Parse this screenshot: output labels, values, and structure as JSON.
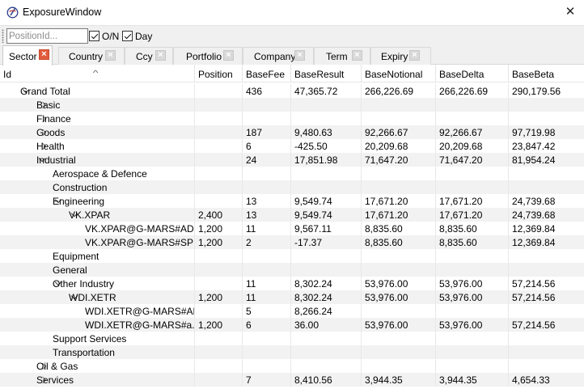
{
  "window": {
    "title": "ExposureWindow",
    "app_icon": "app-logo-icon",
    "close_label": "✕"
  },
  "toolbar": {
    "position_input": {
      "placeholder": "PositionId...",
      "value": ""
    },
    "on_checkbox": {
      "label": "O/N",
      "checked": true
    },
    "day_checkbox": {
      "label": "Day",
      "checked": true
    }
  },
  "tabs": [
    {
      "label": "Sector",
      "active": true
    },
    {
      "label": "Country",
      "active": false
    },
    {
      "label": "Ccy",
      "active": false
    },
    {
      "label": "Portfolio",
      "active": false
    },
    {
      "label": "Company",
      "active": false
    },
    {
      "label": "Term",
      "active": false
    },
    {
      "label": "Expiry",
      "active": false
    }
  ],
  "table": {
    "columns": [
      "Id",
      "Position",
      "BaseFee",
      "BaseResult",
      "BaseNotional",
      "BaseDelta",
      "BaseBeta"
    ],
    "sorted_column": "Id",
    "rows": [
      {
        "id": "Grand Total",
        "level": 0,
        "expander": "expanded",
        "position": "",
        "basefee": "436",
        "baseresult": "47,365.72",
        "basenotional": "266,226.69",
        "basedelta": "266,226.69",
        "basebeta": "290,179.56"
      },
      {
        "id": "Basic",
        "level": 1,
        "expander": "collapsed",
        "position": "",
        "basefee": "",
        "baseresult": "",
        "basenotional": "",
        "basedelta": "",
        "basebeta": ""
      },
      {
        "id": "Finance",
        "level": 1,
        "expander": "collapsed",
        "position": "",
        "basefee": "",
        "baseresult": "",
        "basenotional": "",
        "basedelta": "",
        "basebeta": ""
      },
      {
        "id": "Goods",
        "level": 1,
        "expander": "collapsed",
        "position": "",
        "basefee": "187",
        "baseresult": "9,480.63",
        "basenotional": "92,266.67",
        "basedelta": "92,266.67",
        "basebeta": "97,719.98"
      },
      {
        "id": "Health",
        "level": 1,
        "expander": "collapsed",
        "position": "",
        "basefee": "6",
        "baseresult": "-425.50",
        "basenotional": "20,209.68",
        "basedelta": "20,209.68",
        "basebeta": "23,847.42"
      },
      {
        "id": "Industrial",
        "level": 1,
        "expander": "expanded",
        "position": "",
        "basefee": "24",
        "baseresult": "17,851.98",
        "basenotional": "71,647.20",
        "basedelta": "71,647.20",
        "basebeta": "81,954.24"
      },
      {
        "id": "Aerospace & Defence",
        "level": 2,
        "expander": "none",
        "position": "",
        "basefee": "",
        "baseresult": "",
        "basenotional": "",
        "basedelta": "",
        "basebeta": ""
      },
      {
        "id": "Construction",
        "level": 2,
        "expander": "none",
        "position": "",
        "basefee": "",
        "baseresult": "",
        "basenotional": "",
        "basedelta": "",
        "basebeta": ""
      },
      {
        "id": "Engineering",
        "level": 2,
        "expander": "expanded",
        "position": "",
        "basefee": "13",
        "baseresult": "9,549.74",
        "basenotional": "17,671.20",
        "basedelta": "17,671.20",
        "basebeta": "24,739.68"
      },
      {
        "id": "VK.XPAR",
        "level": 3,
        "expander": "expanded",
        "position": "2,400",
        "basefee": "13",
        "baseresult": "9,549.74",
        "basenotional": "17,671.20",
        "basedelta": "17,671.20",
        "basebeta": "24,739.68"
      },
      {
        "id": "VK.XPAR@G-MARS#AD",
        "level": 4,
        "expander": "none",
        "position": "1,200",
        "basefee": "11",
        "baseresult": "9,567.11",
        "basenotional": "8,835.60",
        "basedelta": "8,835.60",
        "basebeta": "12,369.84"
      },
      {
        "id": "VK.XPAR@G-MARS#SP",
        "level": 4,
        "expander": "none",
        "position": "1,200",
        "basefee": "2",
        "baseresult": "-17.37",
        "basenotional": "8,835.60",
        "basedelta": "8,835.60",
        "basebeta": "12,369.84"
      },
      {
        "id": "Equipment",
        "level": 2,
        "expander": "none",
        "position": "",
        "basefee": "",
        "baseresult": "",
        "basenotional": "",
        "basedelta": "",
        "basebeta": ""
      },
      {
        "id": "General",
        "level": 2,
        "expander": "none",
        "position": "",
        "basefee": "",
        "baseresult": "",
        "basenotional": "",
        "basedelta": "",
        "basebeta": ""
      },
      {
        "id": "Other Industry",
        "level": 2,
        "expander": "expanded",
        "position": "",
        "basefee": "11",
        "baseresult": "8,302.24",
        "basenotional": "53,976.00",
        "basedelta": "53,976.00",
        "basebeta": "57,214.56"
      },
      {
        "id": "WDI.XETR",
        "level": 3,
        "expander": "expanded",
        "position": "1,200",
        "basefee": "11",
        "baseresult": "8,302.24",
        "basenotional": "53,976.00",
        "basedelta": "53,976.00",
        "basebeta": "57,214.56"
      },
      {
        "id": "WDI.XETR@G-MARS#AD",
        "level": 4,
        "expander": "none",
        "position": "",
        "basefee": "5",
        "baseresult": "8,266.24",
        "basenotional": "",
        "basedelta": "",
        "basebeta": ""
      },
      {
        "id": "WDI.XETR@G-MARS#a...",
        "level": 4,
        "expander": "none",
        "position": "1,200",
        "basefee": "6",
        "baseresult": "36.00",
        "basenotional": "53,976.00",
        "basedelta": "53,976.00",
        "basebeta": "57,214.56"
      },
      {
        "id": "Support Services",
        "level": 2,
        "expander": "none",
        "position": "",
        "basefee": "",
        "baseresult": "",
        "basenotional": "",
        "basedelta": "",
        "basebeta": ""
      },
      {
        "id": "Transportation",
        "level": 2,
        "expander": "none",
        "position": "",
        "basefee": "",
        "baseresult": "",
        "basenotional": "",
        "basedelta": "",
        "basebeta": ""
      },
      {
        "id": "Oil & Gas",
        "level": 1,
        "expander": "collapsed",
        "position": "",
        "basefee": "",
        "baseresult": "",
        "basenotional": "",
        "basedelta": "",
        "basebeta": ""
      },
      {
        "id": "Services",
        "level": 1,
        "expander": "collapsed",
        "position": "",
        "basefee": "7",
        "baseresult": "8,410.56",
        "basenotional": "3,944.35",
        "basedelta": "3,944.35",
        "basebeta": "4,654.33"
      }
    ]
  }
}
